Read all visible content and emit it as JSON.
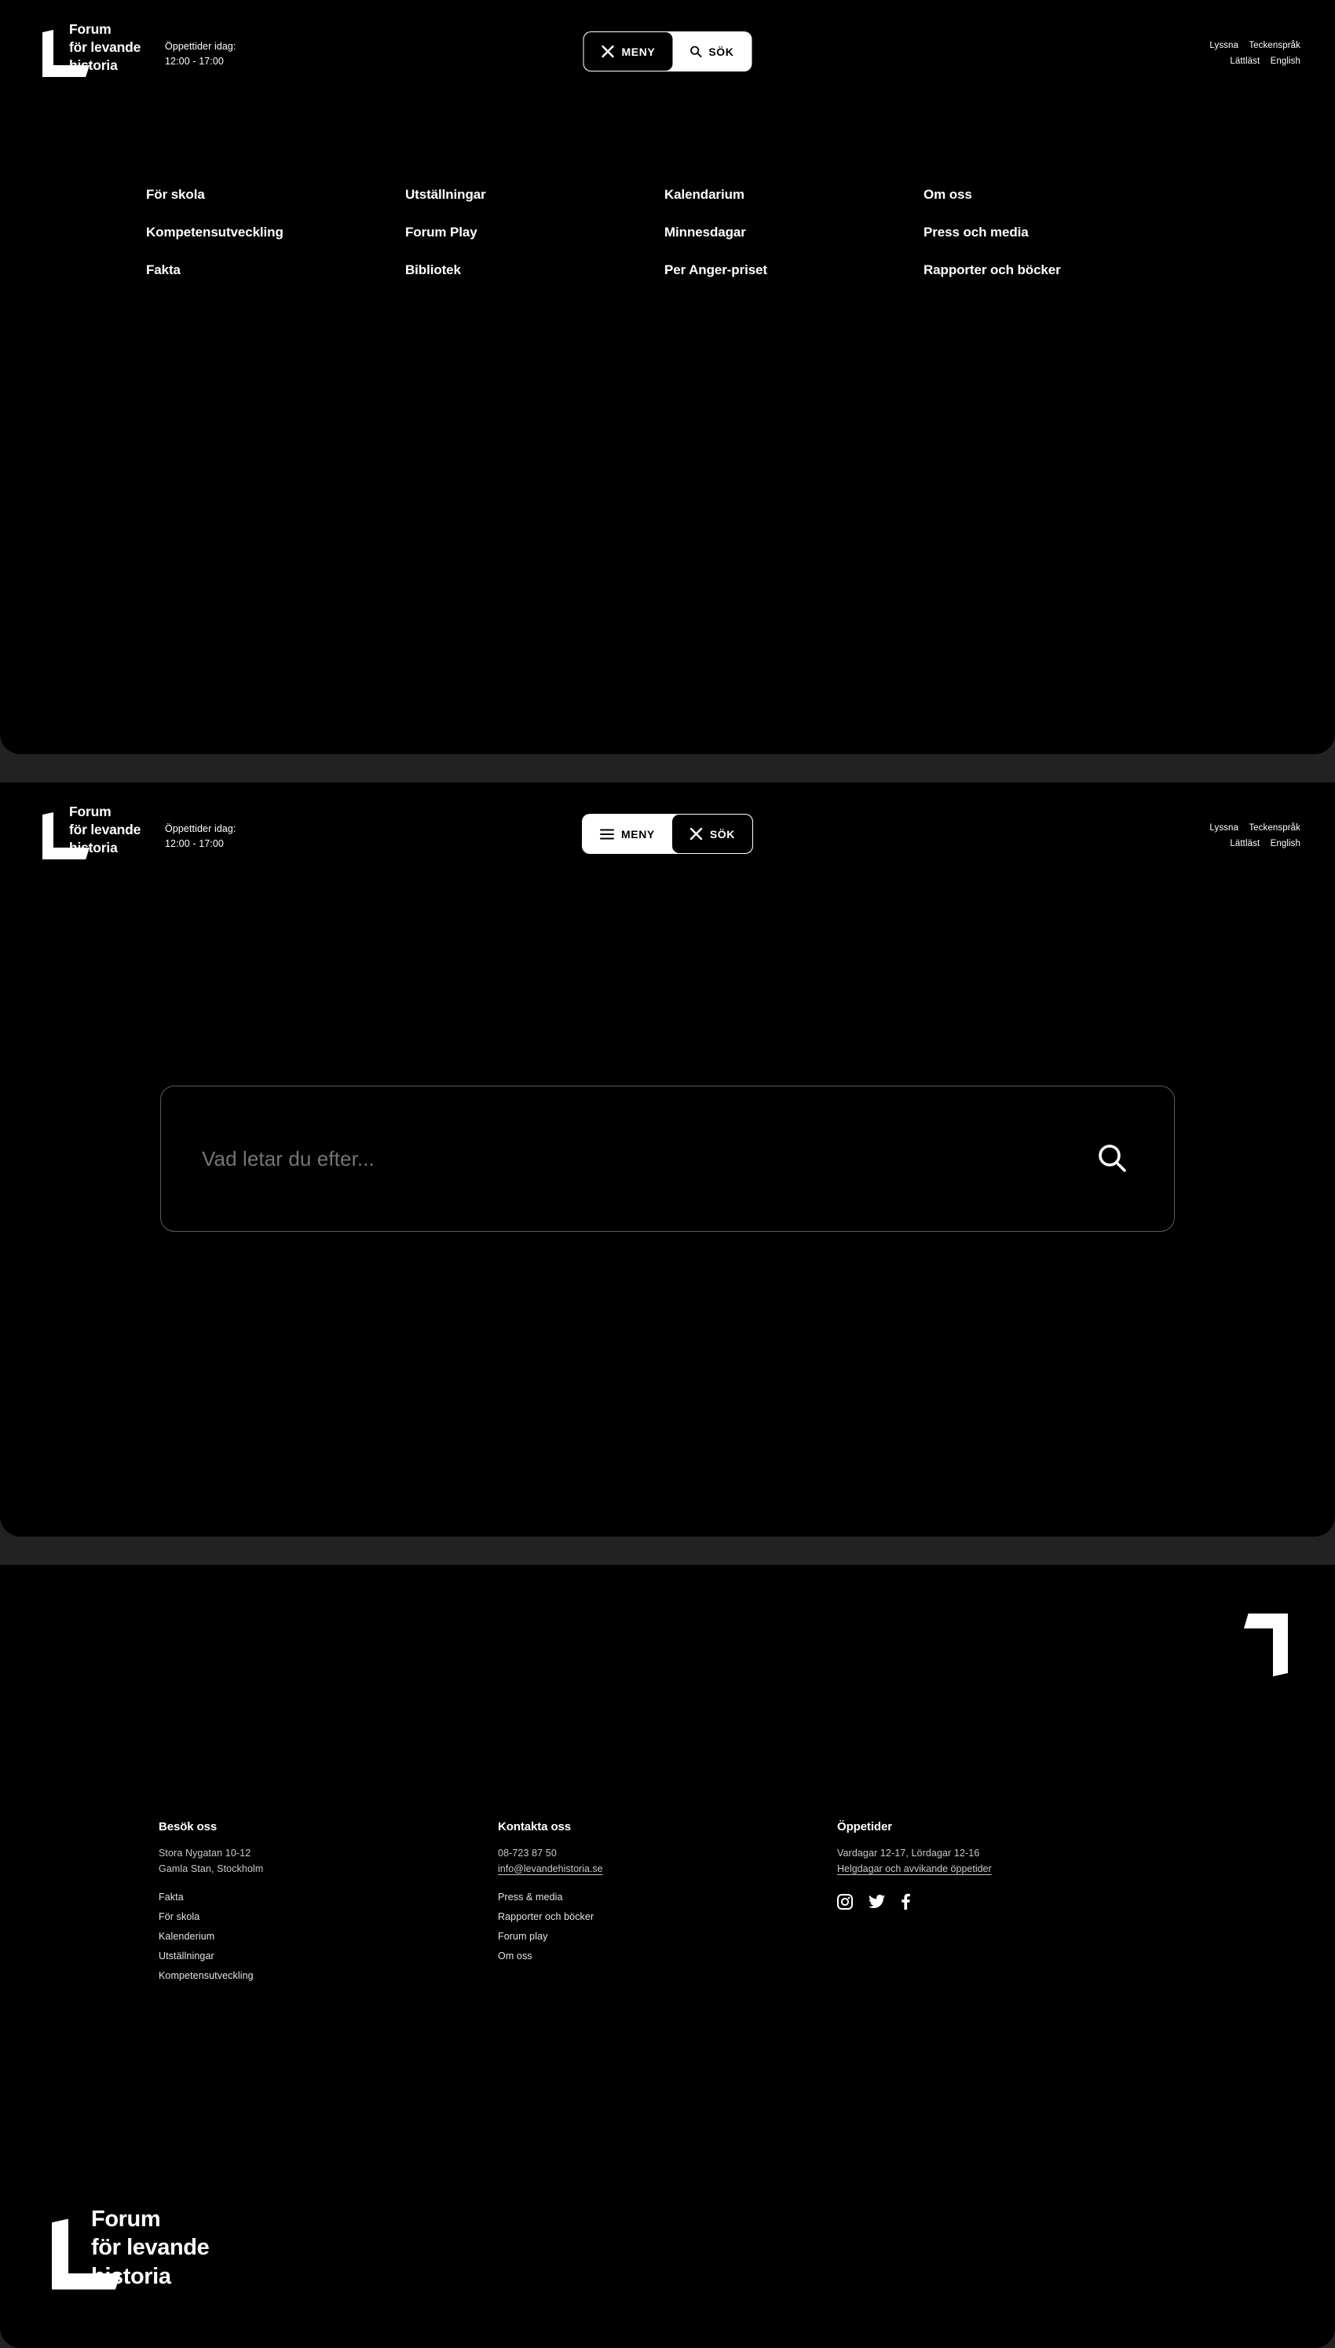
{
  "site": {
    "logo_lines": [
      "Forum",
      "för levande",
      "historia"
    ],
    "logo_icon": "bracket-mark"
  },
  "header": {
    "hours_label": "Öppettider idag:",
    "hours_value": "12:00 - 17:00",
    "menu_button": "MENY",
    "search_button": "SÖK",
    "close_icon": "close-icon",
    "hamburger_icon": "hamburger-icon",
    "search_icon": "search-icon",
    "accessibility": {
      "listen": "Lyssna",
      "sign_language": "Teckenspråk",
      "easy_read": "Lättläst",
      "english": "English"
    }
  },
  "menu_panel": {
    "state": "menu-open",
    "items": [
      "För skola",
      "Utställningar",
      "Kalendarium",
      "Om oss",
      "Kompetensutveckling",
      "Forum Play",
      "Minnesdagar",
      "Press och media",
      "Fakta",
      "Bibliotek",
      "Per Anger-priset",
      "Rapporter och böcker"
    ]
  },
  "search_panel": {
    "state": "search-open",
    "input_value": "",
    "placeholder": "Vad letar du efter...",
    "submit_icon": "search-icon"
  },
  "footer": {
    "corner_icon": "bracket-mark-rotated",
    "columns": [
      {
        "heading": "Besök oss",
        "lines": [
          "Stora Nygatan 10-12",
          "Gamla Stan, Stockholm"
        ],
        "link": null
      },
      {
        "heading": "Kontakta oss",
        "lines": [
          "08-723 87 50"
        ],
        "link": "info@levandehistoria.se"
      },
      {
        "heading": "Öppetider",
        "lines": [
          "Vardagar 12-17, Lördagar 12-16"
        ],
        "link": "Helgdagar och avvikande öppetider"
      }
    ],
    "nav_col_1": [
      "Fakta",
      "För skola",
      "Kalenderium",
      "Utställningar",
      "Kompetensutveckling"
    ],
    "nav_col_2": [
      "Press & media",
      "Rapporter och böcker",
      "Forum play",
      "Om oss"
    ],
    "socials": [
      {
        "name": "instagram-icon"
      },
      {
        "name": "twitter-icon"
      },
      {
        "name": "facebook-icon"
      }
    ],
    "logo_lines": [
      "Forum",
      "för levande",
      "historia"
    ]
  },
  "colors": {
    "page_bg": "#222222",
    "panel_bg": "#000000",
    "text": "#ffffff",
    "muted": "#c9c9c9",
    "placeholder": "#8d8d8d",
    "border": "#5c5c5c",
    "accent_invert": "#ffffff"
  }
}
